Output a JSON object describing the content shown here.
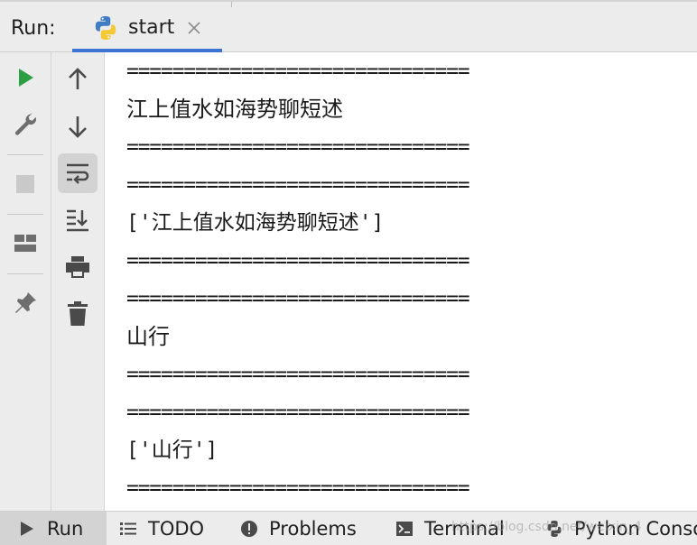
{
  "header": {
    "run_label": "Run:",
    "tab": {
      "label": "start",
      "icon": "python-icon",
      "close_icon": "close-icon"
    }
  },
  "toolbar_left": [
    {
      "name": "run-icon",
      "color": "#2e9e44"
    },
    {
      "name": "wrench-icon"
    },
    {
      "name": "stop-icon"
    },
    {
      "name": "layout-icon"
    },
    {
      "name": "pin-icon"
    }
  ],
  "toolbar_right": [
    {
      "name": "arrow-up-icon"
    },
    {
      "name": "arrow-down-icon"
    },
    {
      "name": "soft-wrap-icon",
      "active": true
    },
    {
      "name": "scroll-to-end-icon"
    },
    {
      "name": "print-icon"
    },
    {
      "name": "trash-icon"
    }
  ],
  "console": {
    "lines": [
      "==============================",
      "江上值水如海势聊短述",
      "==============================",
      "==============================",
      "['江上值水如海势聊短述']",
      "==============================",
      "==============================",
      "山行",
      "==============================",
      "==============================",
      "['山行']",
      "=============================="
    ]
  },
  "bottombar": {
    "items": [
      {
        "label": "Run",
        "icon": "play-icon",
        "active": true
      },
      {
        "label": "TODO",
        "icon": "list-icon"
      },
      {
        "label": "Problems",
        "icon": "warning-icon"
      },
      {
        "label": "Terminal",
        "icon": "terminal-icon"
      },
      {
        "label": "Python Conso",
        "icon": "python-console-icon"
      }
    ],
    "watermark": "https://blog.csdn.net/weixin_4"
  },
  "colors": {
    "accent": "#3b73d4",
    "run_green": "#2e9e44",
    "toolbar_bg": "#ececec"
  }
}
